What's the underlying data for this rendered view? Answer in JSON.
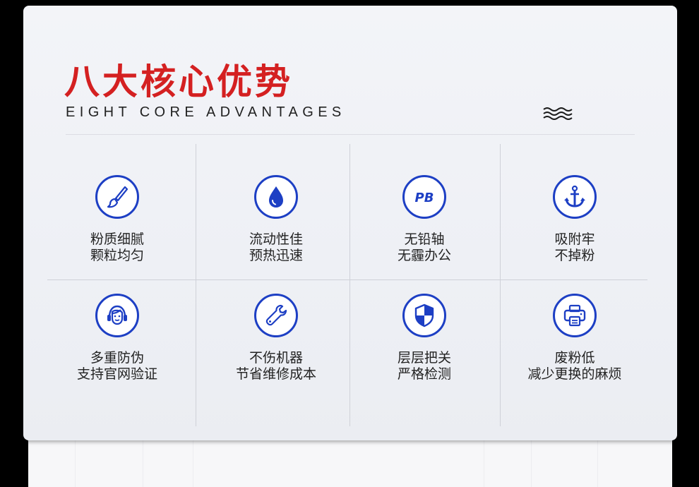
{
  "header": {
    "title": "八大核心优势",
    "subtitle": "EIGHT CORE ADVANTAGES",
    "wave_icon": "wave-icon"
  },
  "colors": {
    "title_red": "#d42021",
    "accent_blue": "#1d3fc4",
    "card_bg": "#f1f2f6",
    "text": "#222222"
  },
  "features": [
    {
      "icon": "brush-icon",
      "line1": "粉质细腻",
      "line2": "颗粒均匀"
    },
    {
      "icon": "water-drop-icon",
      "line1": "流动性佳",
      "line2": "预热迅速"
    },
    {
      "icon": "pb-lead-icon",
      "line1": "无铅轴",
      "line2": "无霾办公"
    },
    {
      "icon": "anchor-icon",
      "line1": "吸附牢",
      "line2": "不掉粉"
    },
    {
      "icon": "headset-support-icon",
      "line1": "多重防伪",
      "line2": "支持官网验证"
    },
    {
      "icon": "wrench-icon",
      "line1": "不伤机器",
      "line2": "节省维修成本"
    },
    {
      "icon": "shield-icon",
      "line1": "层层把关",
      "line2": "严格检测"
    },
    {
      "icon": "printer-icon",
      "line1": "废粉低",
      "line2": "减少更换的麻烦"
    }
  ]
}
